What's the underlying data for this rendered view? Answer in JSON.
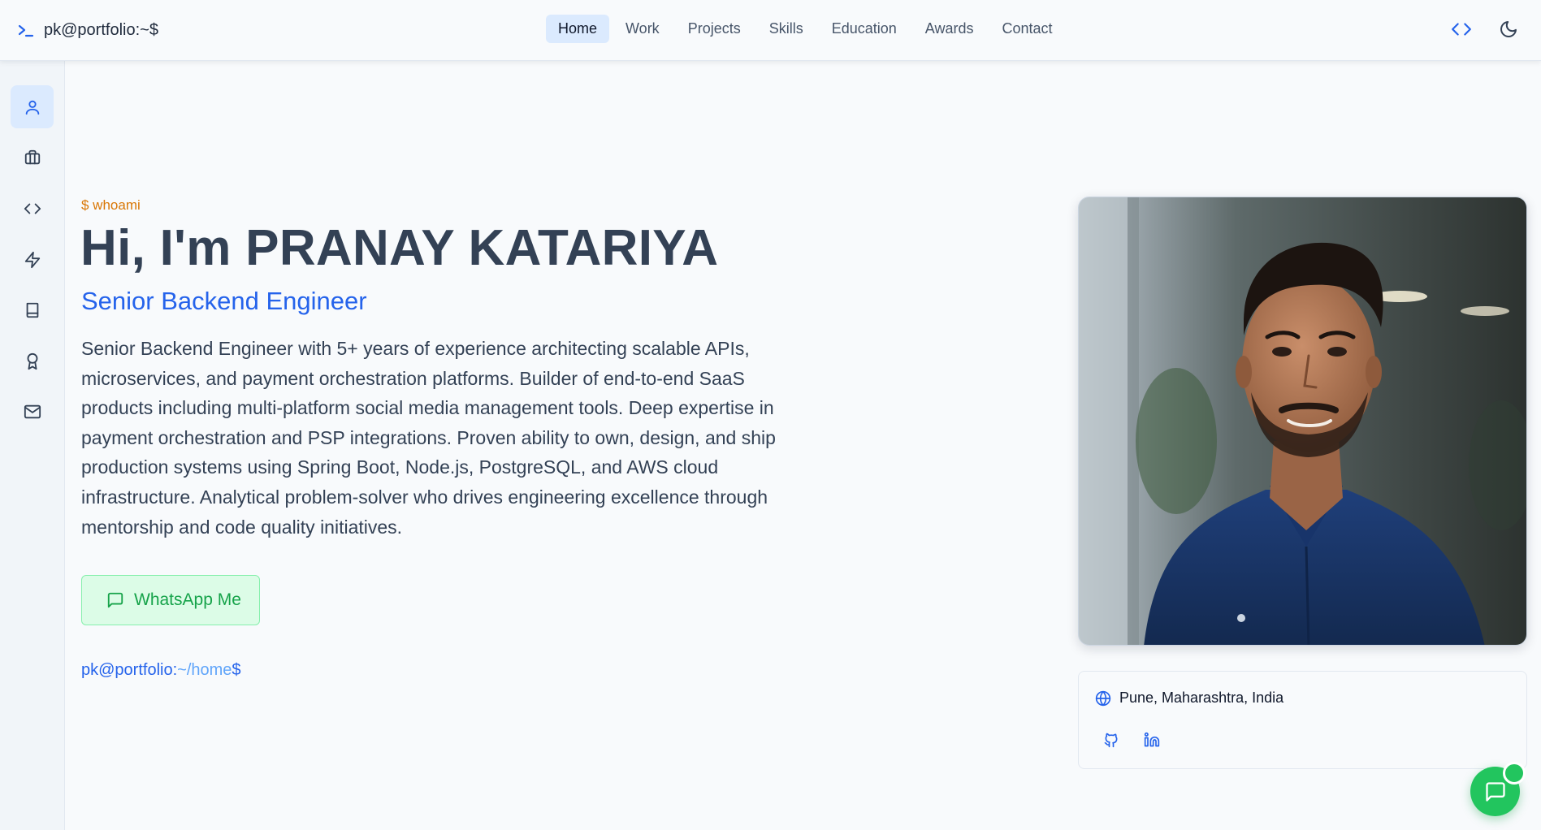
{
  "header": {
    "brand": "pk@portfolio:~$",
    "nav": [
      "Home",
      "Work",
      "Projects",
      "Skills",
      "Education",
      "Awards",
      "Contact"
    ],
    "active_nav": "Home"
  },
  "sidebar": {
    "items": [
      {
        "icon": "user-icon",
        "active": true
      },
      {
        "icon": "briefcase-icon",
        "active": false
      },
      {
        "icon": "code-icon",
        "active": false
      },
      {
        "icon": "lightning-icon",
        "active": false
      },
      {
        "icon": "book-icon",
        "active": false
      },
      {
        "icon": "award-icon",
        "active": false
      },
      {
        "icon": "mail-icon",
        "active": false
      }
    ]
  },
  "hero": {
    "command": "$ whoami",
    "title": "Hi, I'm PRANAY KATARIYA",
    "subtitle": "Senior Backend Engineer",
    "description": "Senior Backend Engineer with 5+ years of experience architecting scalable APIs, microservices, and payment orchestration platforms. Builder of end-to-end SaaS products including multi-platform social media management tools. Deep expertise in payment orchestration and PSP integrations. Proven ability to own, design, and ship production systems using Spring Boot, Node.js, PostgreSQL, and AWS cloud infrastructure. Analytical problem-solver who drives engineering excellence through mentorship and code quality initiatives.",
    "whatsapp_label": "WhatsApp Me",
    "prompt_user": "pk@portfolio:",
    "prompt_path": "~/home",
    "prompt_suffix": "$"
  },
  "profile": {
    "location": "Pune, Maharashtra, India",
    "socials": [
      "github-icon",
      "linkedin-icon"
    ]
  },
  "colors": {
    "accent": "#2563eb",
    "whatsapp": "#22c55e",
    "command": "#d97706"
  }
}
